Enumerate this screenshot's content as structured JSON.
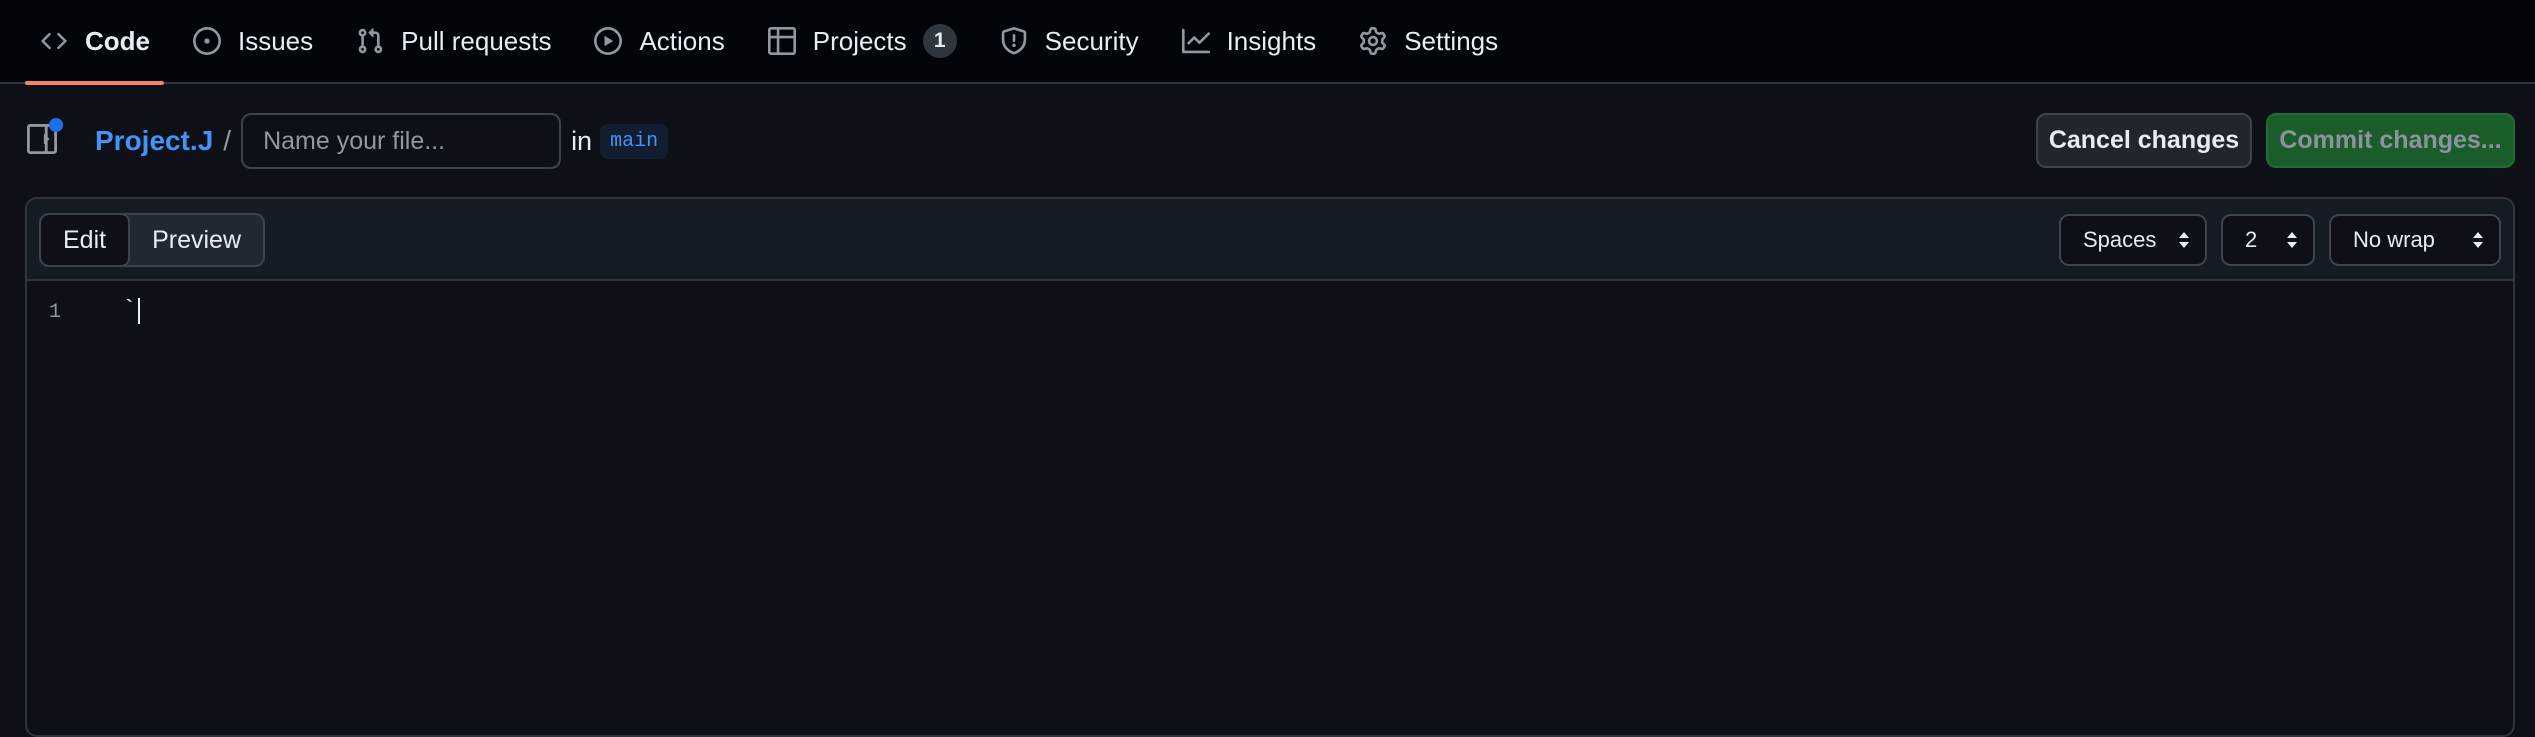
{
  "nav": {
    "items": [
      {
        "label": "Code",
        "icon": "code-icon",
        "active": true
      },
      {
        "label": "Issues",
        "icon": "issue-opened-icon"
      },
      {
        "label": "Pull requests",
        "icon": "git-pull-request-icon"
      },
      {
        "label": "Actions",
        "icon": "play-icon"
      },
      {
        "label": "Projects",
        "icon": "table-icon",
        "counter": "1"
      },
      {
        "label": "Security",
        "icon": "shield-icon"
      },
      {
        "label": "Insights",
        "icon": "graph-icon"
      },
      {
        "label": "Settings",
        "icon": "gear-icon"
      }
    ]
  },
  "file_header": {
    "repo_name": "Project.J",
    "separator": "/",
    "filename_value": "",
    "filename_placeholder": "Name your file...",
    "in_label": "in",
    "branch": "main"
  },
  "actions": {
    "cancel_label": "Cancel changes",
    "commit_label": "Commit changes..."
  },
  "editor": {
    "tabs": [
      {
        "label": "Edit",
        "selected": true
      },
      {
        "label": "Preview",
        "selected": false
      }
    ],
    "indent_mode": "Spaces",
    "indent_size": "2",
    "wrap_mode": "No wrap",
    "lines": [
      {
        "number": "1",
        "text": "`"
      }
    ]
  },
  "colors": {
    "accent_underline": "#f78166",
    "link_blue": "#4493f8",
    "commit_green": "#1a5c2a",
    "background": "#0d1117"
  }
}
